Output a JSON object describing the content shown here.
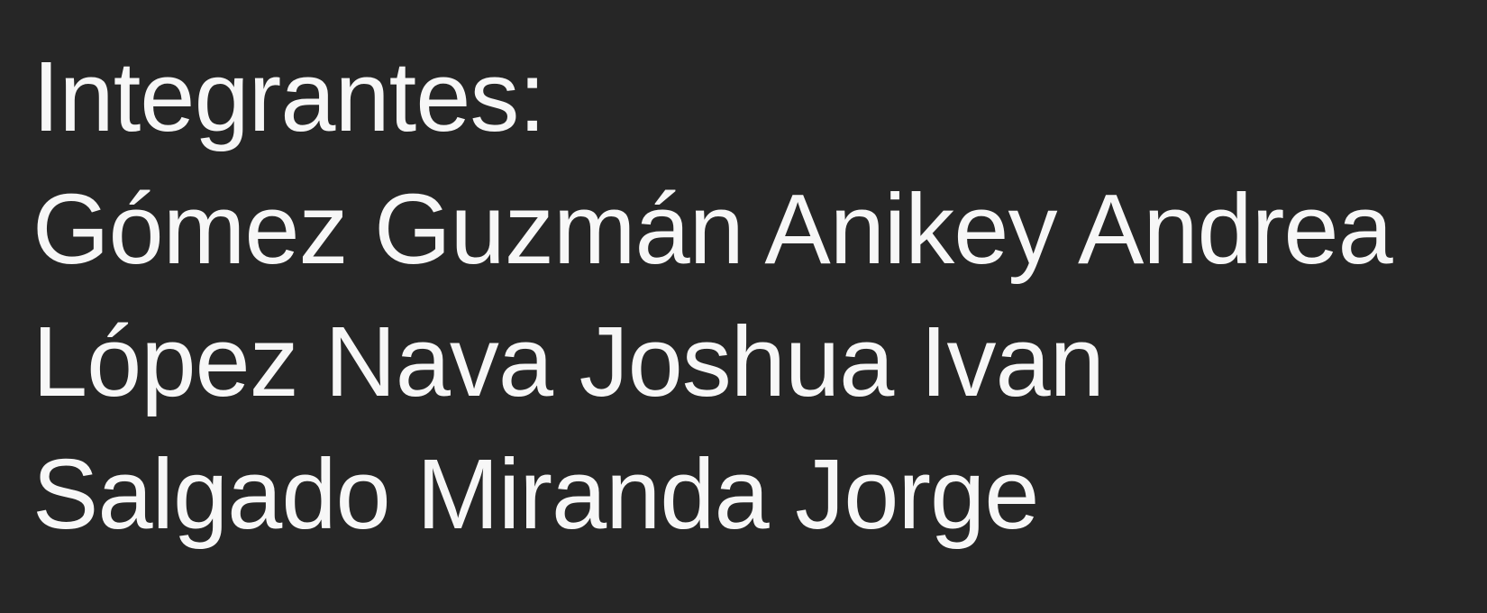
{
  "heading": "Integrantes:",
  "members": [
    "Gómez Guzmán Anikey Andrea",
    "López Nava Joshua Ivan",
    "Salgado Miranda Jorge"
  ],
  "colors": {
    "background": "#262626",
    "text": "#f7f7f7"
  }
}
